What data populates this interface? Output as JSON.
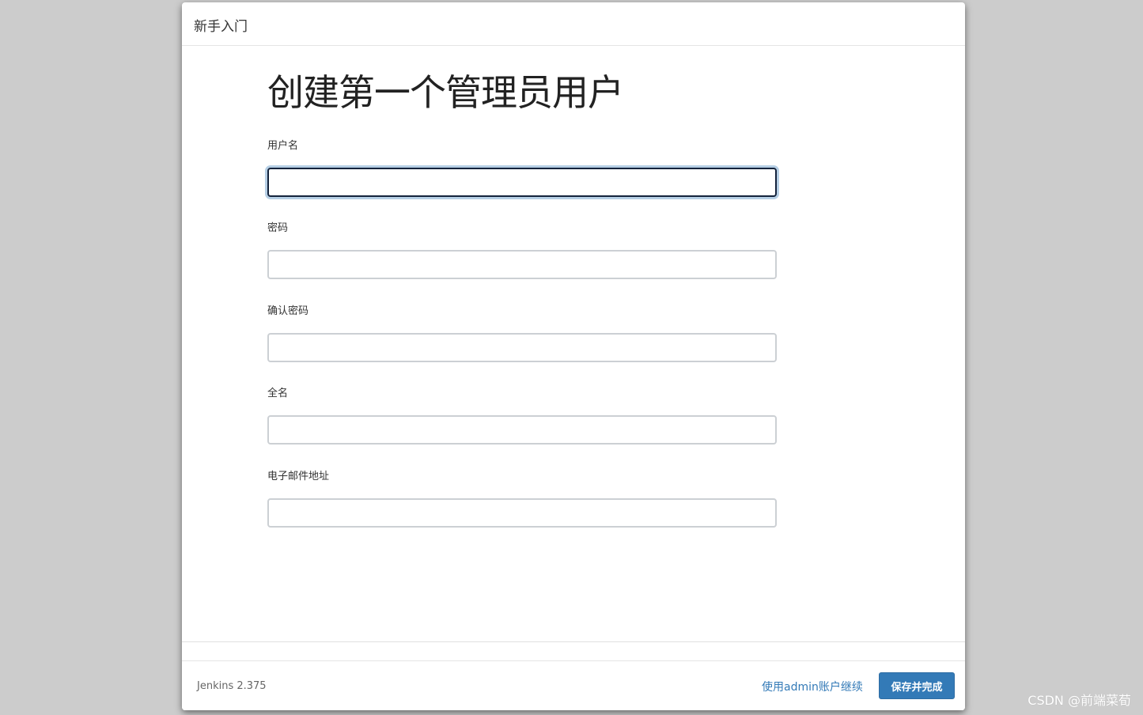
{
  "dialog": {
    "title": "新手入门"
  },
  "main": {
    "heading": "创建第一个管理员用户",
    "fields": [
      {
        "label": "用户名",
        "value": ""
      },
      {
        "label": "密码",
        "value": ""
      },
      {
        "label": "确认密码",
        "value": ""
      },
      {
        "label": "全名",
        "value": ""
      },
      {
        "label": "电子邮件地址",
        "value": ""
      }
    ]
  },
  "footer": {
    "version": "Jenkins 2.375",
    "skip_link": "使用admin账户继续",
    "save_label": "保存并完成"
  },
  "watermark": "CSDN @前端菜荀",
  "colors": {
    "primary": "#337ab7",
    "focus_border": "#14233c",
    "background_overlay": "#cccccc"
  }
}
